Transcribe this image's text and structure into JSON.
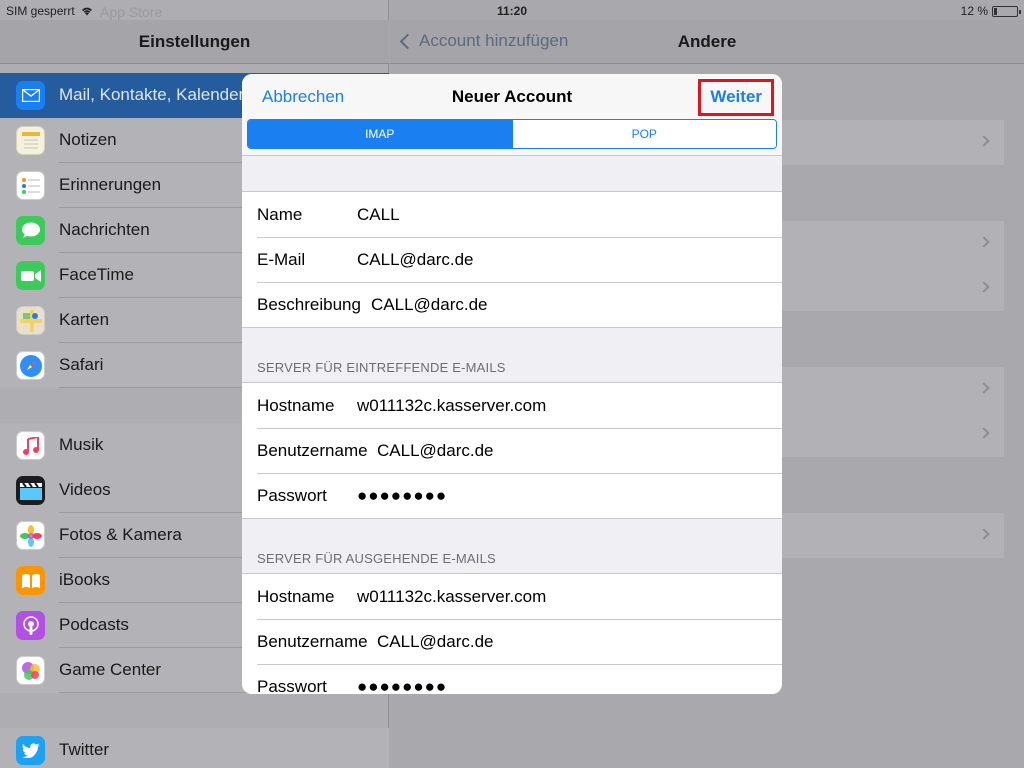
{
  "status_bar": {
    "carrier": "SIM gesperrt",
    "ghost_text": "App Store",
    "time": "11:20",
    "battery": "12 %",
    "battery_level": 0.12
  },
  "master": {
    "title": "Einstellungen",
    "items": [
      {
        "label": "Mail, Kontakte, Kalender",
        "icon": "mail-icon",
        "color": "#1a7ff0",
        "selected": true
      },
      {
        "label": "Notizen",
        "icon": "notes-icon",
        "color": "#f5f1e0"
      },
      {
        "label": "Erinnerungen",
        "icon": "reminders-icon",
        "color": "#ffffff"
      },
      {
        "label": "Nachrichten",
        "icon": "messages-icon",
        "color": "#3ccb5b"
      },
      {
        "label": "FaceTime",
        "icon": "facetime-icon",
        "color": "#3ccb5b"
      },
      {
        "label": "Karten",
        "icon": "maps-icon",
        "color": "#e8e0c8"
      },
      {
        "label": "Safari",
        "icon": "safari-icon",
        "color": "#ffffff"
      },
      {
        "label": "Musik",
        "icon": "music-icon",
        "color": "#ffffff"
      },
      {
        "label": "Videos",
        "icon": "videos-icon",
        "color": "#1c1c1e"
      },
      {
        "label": "Fotos & Kamera",
        "icon": "photos-icon",
        "color": "#ffffff"
      },
      {
        "label": "iBooks",
        "icon": "ibooks-icon",
        "color": "#ff9500"
      },
      {
        "label": "Podcasts",
        "icon": "podcasts-icon",
        "color": "#b150e2"
      },
      {
        "label": "Game Center",
        "icon": "game-center-icon",
        "color": "#ffffff"
      },
      {
        "label": "Twitter",
        "icon": "twitter-icon",
        "color": "#1da1f2"
      }
    ]
  },
  "detail": {
    "back_label": "Account hinzufügen",
    "title": "Andere"
  },
  "modal": {
    "cancel_label": "Abbrechen",
    "title": "Neuer Account",
    "next_label": "Weiter",
    "segments": [
      "IMAP",
      "POP"
    ],
    "active_segment": "IMAP",
    "account": [
      {
        "label": "Name",
        "value": "CALL"
      },
      {
        "label": "E-Mail",
        "value": "CALL@darc.de"
      },
      {
        "label": "Beschreibung",
        "value": "CALL@darc.de"
      }
    ],
    "incoming": {
      "header": "SERVER FÜR EINTREFFENDE E-MAILS",
      "fields": [
        {
          "label": "Hostname",
          "value": "w011132c.kasserver.com"
        },
        {
          "label": "Benutzername",
          "value": "CALL@darc.de"
        },
        {
          "label": "Passwort",
          "value": "●●●●●●●●"
        }
      ]
    },
    "outgoing": {
      "header": "SERVER FÜR AUSGEHENDE E-MAILS",
      "fields": [
        {
          "label": "Hostname",
          "value": "w011132c.kasserver.com"
        },
        {
          "label": "Benutzername",
          "value": "CALL@darc.de"
        },
        {
          "label": "Passwort",
          "value": "●●●●●●●●"
        }
      ]
    }
  },
  "colors": {
    "accent": "#1a7ff0",
    "highlight": "#e0141e"
  }
}
